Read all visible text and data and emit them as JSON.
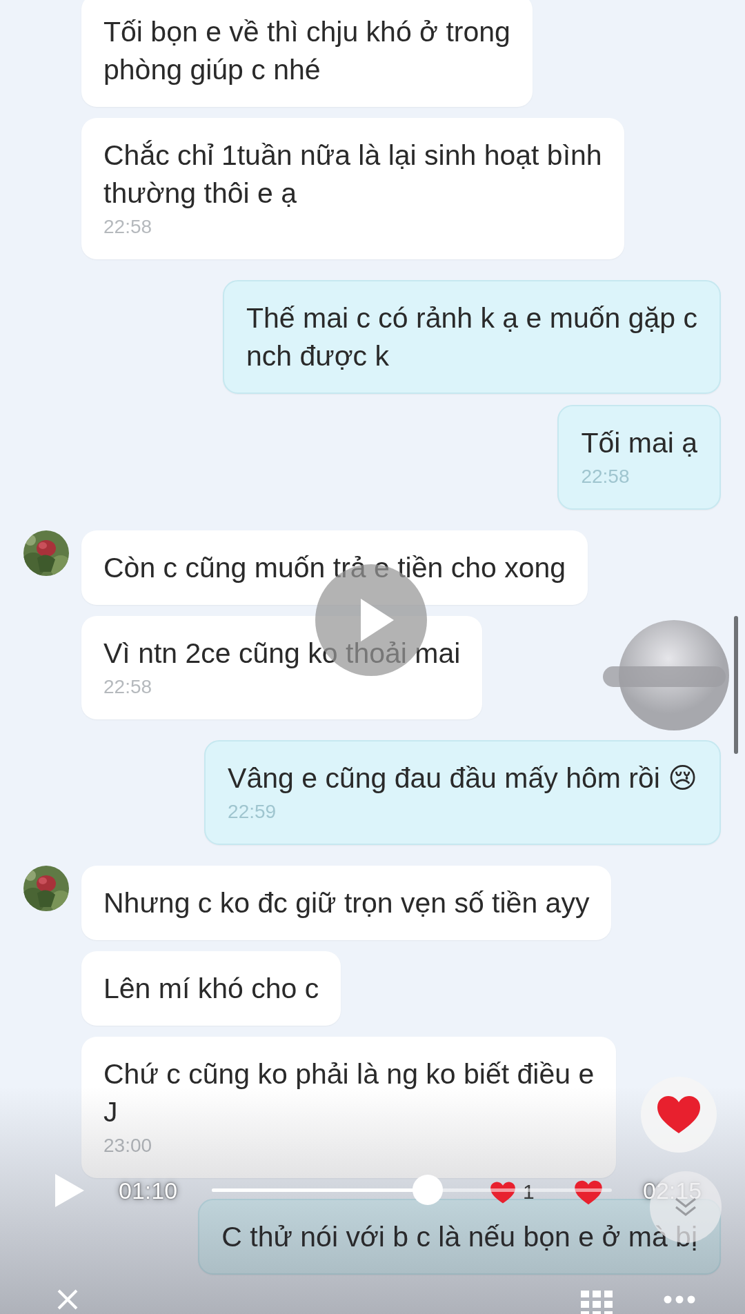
{
  "messages": [
    {
      "kind": "received",
      "avatar": false,
      "text": "Tối bọn e về thì chju khó ở trong\nphòng giúp c nhé"
    },
    {
      "kind": "received",
      "avatar": false,
      "text": "Chắc chỉ 1tuần nữa là lại sinh hoạt bình\nthường thôi e ạ",
      "time": "22:58"
    },
    {
      "kind": "sent",
      "text": "Thế mai c có rảnh k ạ e muốn gặp c\nnch được k"
    },
    {
      "kind": "sent",
      "text": "Tối mai ạ",
      "time": "22:58"
    },
    {
      "kind": "received",
      "avatar": true,
      "text": "Còn c cũng muốn trả e tiền cho xong"
    },
    {
      "kind": "received",
      "avatar": false,
      "text": "Vì ntn 2ce cũng ko thoải mai",
      "time": "22:58"
    },
    {
      "kind": "sent",
      "text": "Vâng e cũng đau đầu mấy hôm rồi 😢",
      "time": "22:59"
    },
    {
      "kind": "received",
      "avatar": true,
      "text": "Nhưng c ko đc giữ trọn vẹn số tiền ayy"
    },
    {
      "kind": "received",
      "avatar": false,
      "text": "Lên mí khó cho c"
    },
    {
      "kind": "received",
      "avatar": false,
      "text": "Chứ c cũng ko phải là ng ko biết điều e\nJ",
      "time": "23:00"
    },
    {
      "kind": "sent",
      "text": "C thử nói với b c là nếu bọn e ở mà bị"
    }
  ],
  "player": {
    "playing": false,
    "elapsed": "01:10",
    "duration": "02:15",
    "level": 0.54,
    "like_count": "1"
  }
}
